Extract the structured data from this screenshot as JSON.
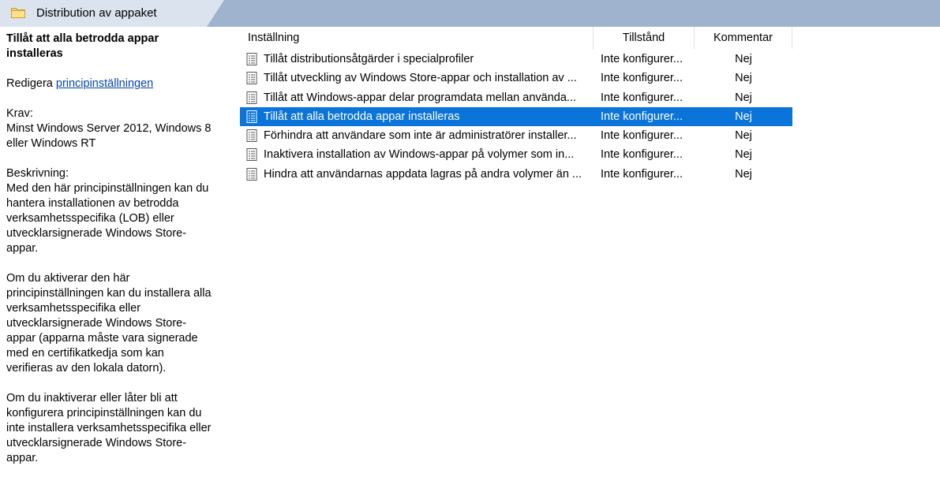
{
  "window": {
    "title": "Distribution av appaket",
    "folder_icon": "folder-icon"
  },
  "description": {
    "title": "Tillåt att alla betrodda appar installeras",
    "edit_prefix": "Redigera ",
    "edit_link": "principinställningen",
    "requirements_label": "Krav:",
    "requirements_text": "Minst Windows Server 2012, Windows 8 eller Windows RT",
    "description_label": "Beskrivning:",
    "paragraph1": "Med den här principinställningen kan du hantera installationen av betrodda verksamhetsspecifika (LOB) eller utvecklarsignerade Windows Store-appar.",
    "paragraph2": "Om du aktiverar den här principinställningen kan du installera alla verksamhetsspecifika eller utvecklarsignerade Windows Store-appar (apparna måste vara signerade med en certifikatkedja som kan verifieras av den lokala datorn).",
    "paragraph3": "Om du inaktiverar eller låter bli att konfigurera principinställningen kan du inte installera verksamhetsspecifika eller utvecklarsignerade Windows Store-appar."
  },
  "list": {
    "columns": {
      "setting": "Inställning",
      "state": "Tillstånd",
      "comment": "Kommentar"
    },
    "selected_index": 3,
    "row_icon": "policy-setting-icon",
    "rows": [
      {
        "name": "Tillåt distributionsåtgärder i specialprofiler",
        "state": "Inte konfigurer...",
        "comment": "Nej"
      },
      {
        "name": "Tillåt utveckling av Windows Store-appar och installation av ...",
        "state": "Inte konfigurer...",
        "comment": "Nej"
      },
      {
        "name": "Tillåt att Windows-appar delar programdata mellan använda...",
        "state": "Inte konfigurer...",
        "comment": "Nej"
      },
      {
        "name": "Tillåt att alla betrodda appar installeras",
        "state": "Inte konfigurer...",
        "comment": "Nej"
      },
      {
        "name": "Förhindra att användare som inte är administratörer installer...",
        "state": "Inte konfigurer...",
        "comment": "Nej"
      },
      {
        "name": "Inaktivera installation av Windows-appar på volymer som in...",
        "state": "Inte konfigurer...",
        "comment": "Nej"
      },
      {
        "name": "Hindra att användarnas appdata lagras på andra volymer än ...",
        "state": "Inte konfigurer...",
        "comment": "Nej"
      }
    ]
  },
  "colors": {
    "selection": "#0a74da",
    "header_bar": "#9fb3cf",
    "link": "#0645ad"
  }
}
